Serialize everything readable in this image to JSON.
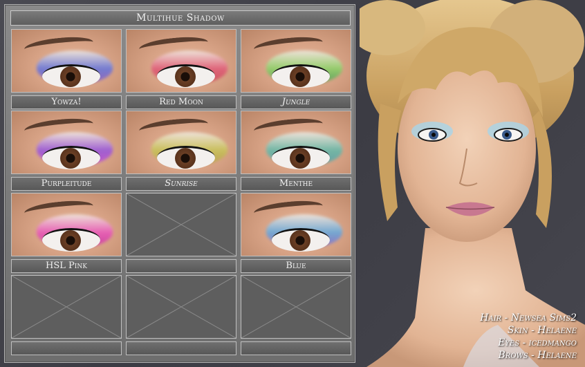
{
  "title": "Multihue Shadow",
  "swatches": [
    {
      "label": "Yowza!",
      "italic": false,
      "shadow": [
        "#6a78d8",
        "#8d5fc0"
      ],
      "empty": false
    },
    {
      "label": "Red Moon",
      "italic": false,
      "shadow": [
        "#e0607a",
        "#c94a5a"
      ],
      "empty": false
    },
    {
      "label": "Jungle",
      "italic": true,
      "shadow": [
        "#8fd06a",
        "#4f9d5a"
      ],
      "empty": false
    },
    {
      "label": "Purpleitude",
      "italic": false,
      "shadow": [
        "#9a5ad8",
        "#c24fd0"
      ],
      "empty": false
    },
    {
      "label": "Sunrise",
      "italic": true,
      "shadow": [
        "#c8c25a",
        "#b8a050"
      ],
      "empty": false
    },
    {
      "label": "Menthe",
      "italic": false,
      "shadow": [
        "#6ab8a8",
        "#5aa0a8"
      ],
      "empty": false
    },
    {
      "label": "HSL Pink",
      "italic": false,
      "shadow": [
        "#e85ab8",
        "#c83aa0"
      ],
      "empty": false
    },
    {
      "label": "",
      "italic": false,
      "shadow": [],
      "empty": true
    },
    {
      "label": "Blue",
      "italic": false,
      "shadow": [
        "#6aa8d8",
        "#8a6ac8"
      ],
      "empty": false
    },
    {
      "label": "",
      "italic": false,
      "shadow": [],
      "empty": true
    },
    {
      "label": "",
      "italic": false,
      "shadow": [],
      "empty": true
    },
    {
      "label": "",
      "italic": false,
      "shadow": [],
      "empty": true
    }
  ],
  "credits": [
    "Hair - Newsea Sims2",
    "Skin - Helaene",
    "Eyes - icedmango",
    "Brows - Helaene"
  ],
  "colors": {
    "panel": "#7a7a7a",
    "frame": "#c0c0c0",
    "background": "#45454d",
    "hair": "#d4b070",
    "skin": "#e8c0a0"
  }
}
